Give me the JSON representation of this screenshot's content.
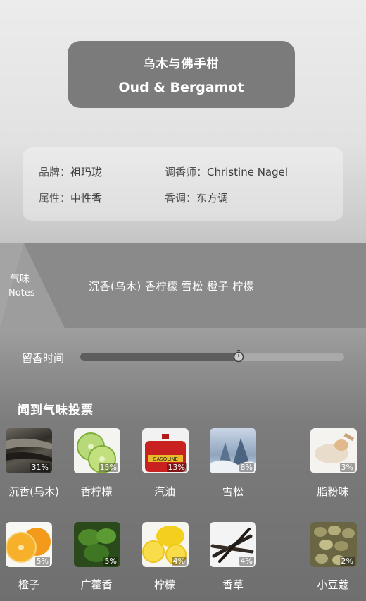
{
  "perfume": {
    "name_zh": "乌木与佛手柑",
    "name_en": "Oud & Bergamot"
  },
  "info": {
    "brand_label": "品牌：",
    "brand_value": "祖玛珑",
    "perfumer_label": "调香师：",
    "perfumer_value": "Christine Nagel",
    "attribute_label": "属性：",
    "attribute_value": "中性香",
    "accord_label": "香调：",
    "accord_value": "东方调"
  },
  "notes": {
    "label_zh": "气味",
    "label_en": "Notes",
    "text": "沉香(乌木) 香柠檬 雪松 橙子 柠檬"
  },
  "longevity": {
    "label": "留香时间",
    "level": 0.6
  },
  "vote": {
    "title": "闻到气味投票",
    "items": [
      {
        "label": "沉香(乌木)",
        "pct": "31%",
        "icon": "agarwood-image"
      },
      {
        "label": "香柠檬",
        "pct": "15%",
        "icon": "bergamot-image"
      },
      {
        "label": "汽油",
        "pct": "13%",
        "icon": "gasoline-can-image"
      },
      {
        "label": "雪松",
        "pct": "8%",
        "icon": "cedar-image"
      },
      {
        "label": "脂粉味",
        "pct": "3%",
        "icon": "powder-image"
      },
      {
        "label": "橙子",
        "pct": "5%",
        "icon": "orange-image"
      },
      {
        "label": "广藿香",
        "pct": "5%",
        "icon": "patchouli-image"
      },
      {
        "label": "柠檬",
        "pct": "4%",
        "icon": "lemon-image"
      },
      {
        "label": "香草",
        "pct": "4%",
        "icon": "vanilla-image"
      },
      {
        "label": "小豆蔻",
        "pct": "2%",
        "icon": "cardamom-image"
      }
    ]
  }
}
